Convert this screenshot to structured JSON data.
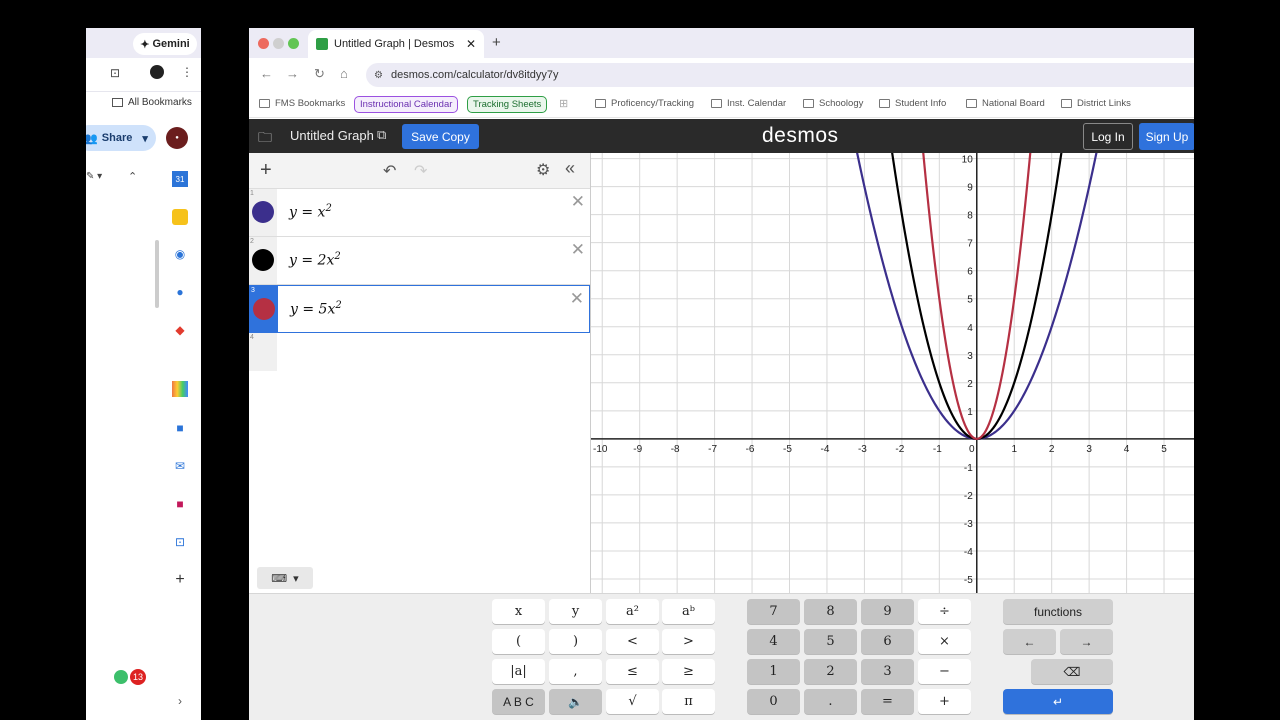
{
  "left_window": {
    "gemini_label": "Gemini",
    "all_bookmarks": "All Bookmarks",
    "share_label": "Share",
    "notification_count": "13"
  },
  "browser": {
    "tab_title": "Untitled Graph | Desmos",
    "url": "desmos.com/calculator/dv8itdyy7y",
    "bookmarks": [
      "FMS Bookmarks",
      "Proficency/Tracking",
      "Inst. Calendar",
      "Schoology",
      "Student Info",
      "National Board",
      "District Links"
    ],
    "chips": [
      "Instructional Calendar",
      "Tracking Sheets"
    ]
  },
  "desmos": {
    "graph_title": "Untitled Graph",
    "save_copy": "Save Copy",
    "logo": "desmos",
    "log_in": "Log In",
    "sign_up": "Sign Up"
  },
  "expressions": [
    {
      "num": "1",
      "latex_lhs": "y = x",
      "exp": "2",
      "color": "#3b2f8c"
    },
    {
      "num": "2",
      "latex_lhs": "y = 2x",
      "exp": "2",
      "color": "#000000"
    },
    {
      "num": "3",
      "latex_lhs": "y = 5x",
      "exp": "2",
      "color": "#b53043"
    },
    {
      "num": "4"
    }
  ],
  "chart_data": {
    "type": "line",
    "series": [
      {
        "name": "y = x^2",
        "coef": 1,
        "color": "#3b2f8c"
      },
      {
        "name": "y = 2x^2",
        "coef": 2,
        "color": "#000000"
      },
      {
        "name": "y = 5x^2",
        "coef": 5,
        "color": "#b53043"
      }
    ],
    "xlim": [
      -10.3,
      5.8
    ],
    "ylim": [
      -5.5,
      10.2
    ],
    "x_ticks": [
      -10,
      -9,
      -8,
      -7,
      -6,
      -5,
      -4,
      -3,
      -2,
      -1,
      0,
      1,
      2,
      3,
      4,
      5
    ],
    "y_ticks": [
      -5,
      -4,
      -3,
      -2,
      -1,
      1,
      2,
      3,
      4,
      5,
      6,
      7,
      8,
      9,
      10
    ],
    "grid": true
  },
  "keypad": {
    "left": [
      [
        "x",
        "y",
        "a²",
        "aᵇ"
      ],
      [
        "(",
        ")",
        "<",
        ">"
      ],
      [
        "|a|",
        ",",
        "≤",
        "≥"
      ],
      [
        "A B C",
        "🔈",
        "√",
        "π"
      ]
    ],
    "mid": [
      [
        "7",
        "8",
        "9",
        "÷"
      ],
      [
        "4",
        "5",
        "6",
        "×"
      ],
      [
        "1",
        "2",
        "3",
        "−"
      ],
      [
        "0",
        ".",
        "=",
        "+"
      ]
    ],
    "functions": "functions",
    "left_arrow": "←",
    "right_arrow": "→",
    "backspace": "⌫",
    "enter": "↵"
  }
}
